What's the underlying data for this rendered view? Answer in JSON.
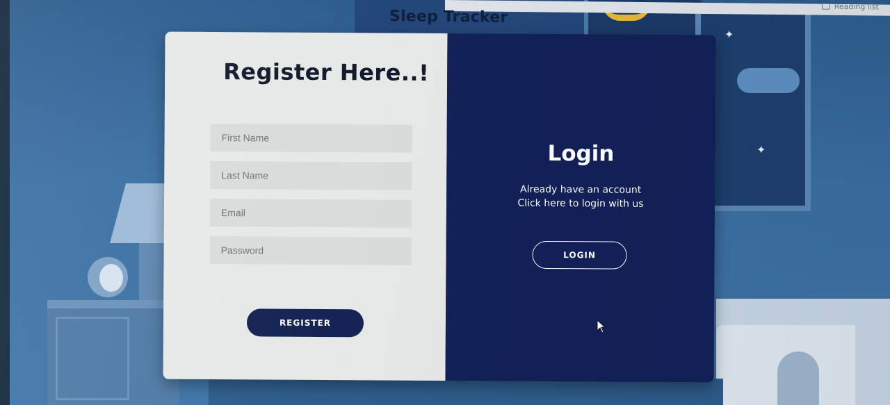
{
  "browser": {
    "reading_list_label": "Reading list"
  },
  "app": {
    "title": "Sleep Tracker"
  },
  "register": {
    "heading": "Register Here..!",
    "fields": {
      "first_name_placeholder": "First Name",
      "last_name_placeholder": "Last Name",
      "email_placeholder": "Email",
      "password_placeholder": "Password"
    },
    "button_label": "REGISTER"
  },
  "login": {
    "heading": "Login",
    "line1": "Already have an account",
    "line2": "Click here to login with us",
    "button_label": "LOGIN"
  },
  "colors": {
    "card_left_bg": "#e6e9e8",
    "card_right_bg": "#122159",
    "button_dark": "#152454",
    "background_blue": "#3a6fa2"
  },
  "icons": {
    "reading_list": "reading-list-icon",
    "mouse_cursor": "arrow-cursor-icon",
    "stars": "sparkle-star-icon",
    "moon": "crescent-moon-icon"
  }
}
